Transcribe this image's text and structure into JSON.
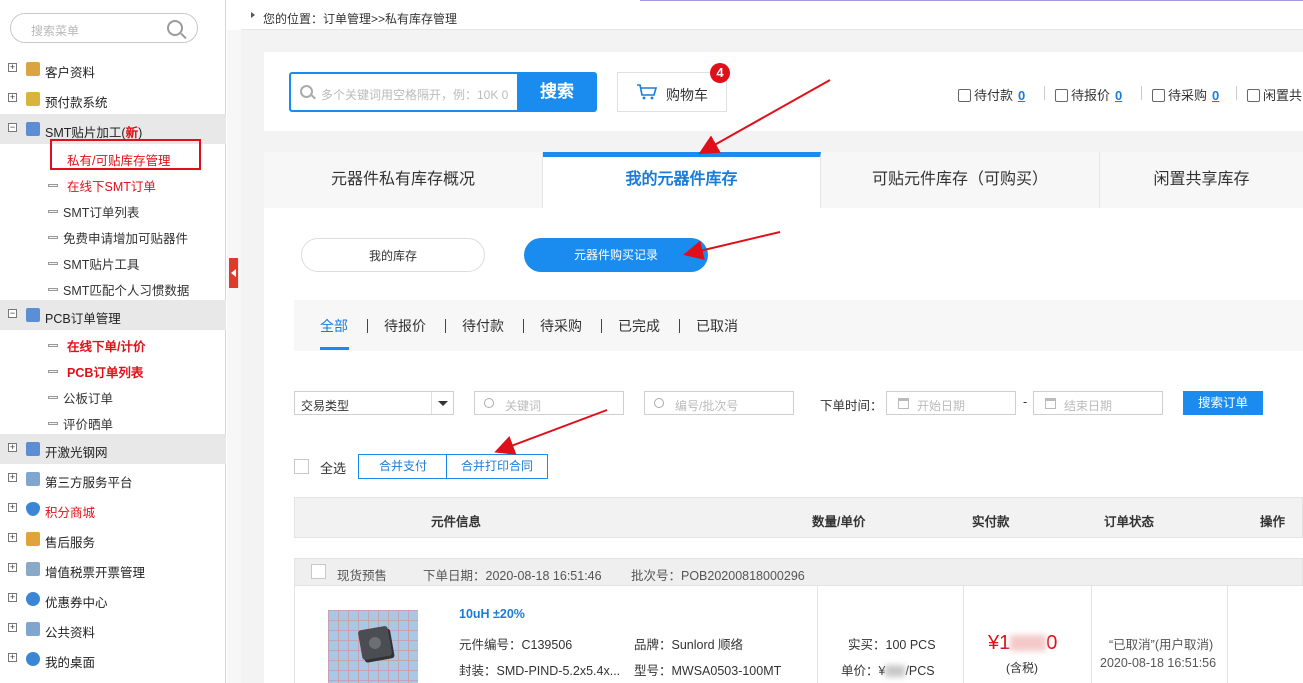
{
  "sidebar": {
    "search_placeholder": "搜索菜单",
    "groups": [
      {
        "label": "客户资料"
      },
      {
        "label": "预付款系统"
      },
      {
        "label": "SMT贴片加工(",
        "badge": "新",
        "badge_close": ")"
      },
      {
        "label": "PCB订单管理"
      },
      {
        "label": "开激光钢网"
      },
      {
        "label": "第三方服务平台"
      },
      {
        "label": "积分商城"
      },
      {
        "label": "售后服务"
      },
      {
        "label": "增值税票开票管理"
      },
      {
        "label": "优惠券中心"
      },
      {
        "label": "公共资料"
      },
      {
        "label": "我的桌面"
      }
    ],
    "smt_items": [
      {
        "label": "私有/可贴库存管理"
      },
      {
        "label": "在线下SMT订单"
      },
      {
        "label": "SMT订单列表"
      },
      {
        "label": "免费申请增加可贴器件"
      },
      {
        "label": "SMT贴片工具"
      },
      {
        "label": "SMT匹配个人习惯数据"
      }
    ],
    "pcb_items": [
      {
        "label": "在线下单/计价"
      },
      {
        "label": "PCB订单列表"
      },
      {
        "label": "公板订单"
      },
      {
        "label": "评价晒单"
      }
    ],
    "colors": {
      "highlight": "#e0101a",
      "group_bg": "#e8e8e8"
    }
  },
  "breadcrumb": "您的位置：订单管理>>私有库存管理",
  "search": {
    "placeholder": "多个关键词用空格隔开，例：10K 0",
    "button": "搜索",
    "cart_label": "购物车",
    "cart_count": "4"
  },
  "status_links": [
    {
      "label": "待付款",
      "count": "0"
    },
    {
      "label": "待报价",
      "count": "0"
    },
    {
      "label": "待采购",
      "count": "0"
    },
    {
      "label": "闲置共"
    }
  ],
  "main_tabs": [
    {
      "label": "元器件私有库存概况"
    },
    {
      "label": "我的元器件库存"
    },
    {
      "label": "可贴元件库存（可购买）"
    },
    {
      "label": "闲置共享库存"
    }
  ],
  "sub_pills": {
    "my_stock": "我的库存",
    "purchase_records": "元器件购买记录"
  },
  "filter_tabs": [
    "全部",
    "待报价",
    "待付款",
    "待采购",
    "已完成",
    "已取消"
  ],
  "filters": {
    "type_select": "交易类型",
    "keyword_placeholder": "关键词",
    "code_placeholder": "编号/批次号",
    "date_label": "下单时间：",
    "start_placeholder": "开始日期",
    "date_sep": "-",
    "end_placeholder": "结束日期",
    "search_button": "搜索订单"
  },
  "actions": {
    "select_all": "全选",
    "merge_pay": "合并支付",
    "merge_print": "合并打印合同"
  },
  "table_headers": [
    "元件信息",
    "数量/单价",
    "实付款",
    "订单状态",
    "操作"
  ],
  "order": {
    "tag": "现货预售",
    "order_date": "下单日期：2020-08-18 16:51:46",
    "batch_no": "批次号：POB20200818000296",
    "product_name": "10uH ±20%",
    "part_no": "元件编号：C139506",
    "brand": "品牌：Sunlord 顺络",
    "package": "封装：SMD-PIND-5.2x5.4x...",
    "model": "型号：MWSA0503-100MT",
    "qty": "实买：100 PCS",
    "unit_price_prefix": "单价：¥",
    "unit_price_suffix": "/PCS",
    "paid_prefix": "¥1",
    "paid_suffix": "0",
    "tax": "(含税)",
    "status": "“已取消”(用户取消)",
    "status_time": "2020-08-18 16:51:56"
  }
}
